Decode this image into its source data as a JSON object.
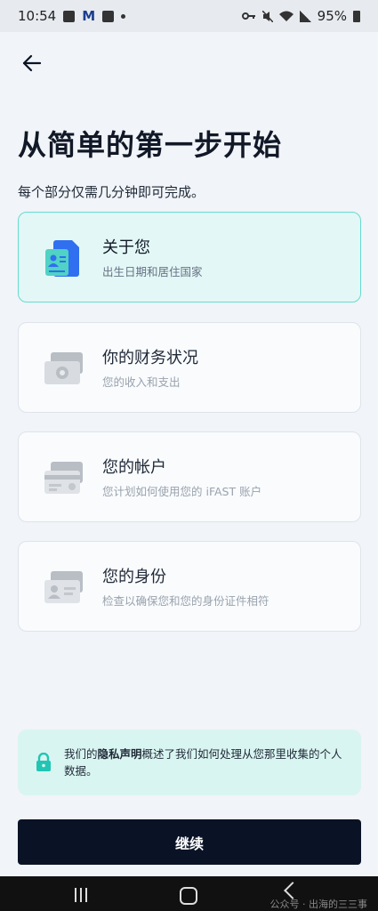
{
  "status_bar": {
    "time": "10:54",
    "mail_letter": "M",
    "battery": "95%",
    "icons": [
      "image-icon",
      "gmail-icon",
      "task-icon",
      "dot-icon",
      "key-icon",
      "mute-icon",
      "wifi-icon",
      "signal-icon",
      "battery-icon"
    ]
  },
  "header": {
    "back_icon": "arrow-left-icon"
  },
  "page": {
    "title": "从简单的第一步开始",
    "subtitle": "每个部分仅需几分钟即可完成。"
  },
  "sections": [
    {
      "title": "关于您",
      "desc": "出生日期和居住国家",
      "icon": "document-person-icon",
      "active": true
    },
    {
      "title": "你的财务状况",
      "desc": "您的收入和支出",
      "icon": "money-icon",
      "active": false
    },
    {
      "title": "您的帐户",
      "desc": "您计划如何使用您的 iFAST 账户",
      "icon": "card-icon",
      "active": false
    },
    {
      "title": "您的身份",
      "desc": "检查以确保您和您的身份证件相符",
      "icon": "id-card-icon",
      "active": false
    }
  ],
  "privacy_notice": {
    "prefix": "我们的",
    "link": "隐私声明",
    "suffix": "概述了我们如何处理从您那里收集的个人数据。",
    "icon": "lock-icon"
  },
  "continue_button": {
    "label": "继续"
  },
  "nav_bar": {
    "watermark": "公众号 · 出海的三三事",
    "icons": [
      "recent-apps-icon",
      "home-icon",
      "back-icon"
    ]
  },
  "colors": {
    "accent_bg": "#e3f8f6",
    "accent_border": "#66dbd0",
    "button_bg": "#0a1326",
    "notice_bg": "#d9f5f1",
    "icon_blue": "#2f6ff0",
    "icon_teal": "#50d2c4"
  }
}
